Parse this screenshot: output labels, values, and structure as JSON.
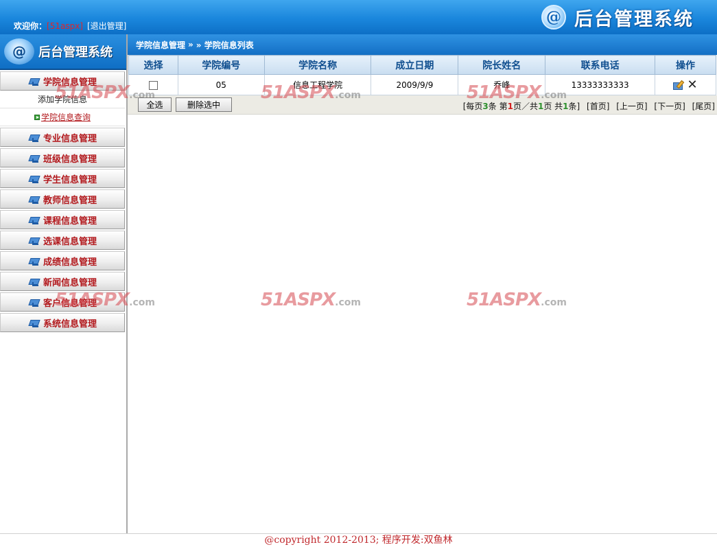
{
  "header": {
    "welcome_label": "欢迎你：",
    "username": "[51aspx]",
    "logout": "[退出管理]",
    "logo_mark": "@",
    "system_title": "后台管理系统"
  },
  "sidebar": {
    "brand_title": "后台管理系统",
    "brand_mark": "@",
    "menu": [
      {
        "label": "学院信息管理"
      },
      {
        "label": "专业信息管理"
      },
      {
        "label": "班级信息管理"
      },
      {
        "label": "学生信息管理"
      },
      {
        "label": "教师信息管理"
      },
      {
        "label": "课程信息管理"
      },
      {
        "label": "选课信息管理"
      },
      {
        "label": "成绩信息管理"
      },
      {
        "label": "新闻信息管理"
      },
      {
        "label": "客户信息管理"
      },
      {
        "label": "系统信息管理"
      }
    ],
    "submenu": [
      {
        "label": "添加学院信息"
      },
      {
        "label": "学院信息查询"
      }
    ]
  },
  "breadcrumb": {
    "section": "学院信息管理",
    "separator": "»",
    "page": "» 学院信息列表"
  },
  "table": {
    "columns": [
      "选择",
      "学院编号",
      "学院名称",
      "成立日期",
      "院长姓名",
      "联系电话",
      "操作"
    ],
    "rows": [
      {
        "id": "05",
        "name": "信息工程学院",
        "founded": "2009/9/9",
        "dean": "乔峰",
        "phone": "13333333333"
      }
    ]
  },
  "actions": {
    "select_all": "全选",
    "delete_selected": "删除选中"
  },
  "pager": {
    "prefix": "[每页",
    "per_page": "3",
    "mid1": "条 第",
    "current": "1",
    "mid2": "页／共",
    "total_pages": "1",
    "mid3": "页 共",
    "total_items": "1",
    "suffix": "条]",
    "first": "[首页]",
    "prev": "[上一页]",
    "next": "[下一页]",
    "last": "[尾页]"
  },
  "watermark": {
    "text": "51ASPX",
    "suffix": ".com"
  },
  "footer": {
    "text": "@copyright 2012-2013; 程序开发:双鱼林"
  },
  "colors": {
    "header_blue": "#1a86dc",
    "menu_red": "#b2181c",
    "heading_blue": "#0f4e8f",
    "footer_red": "#c0282c"
  }
}
